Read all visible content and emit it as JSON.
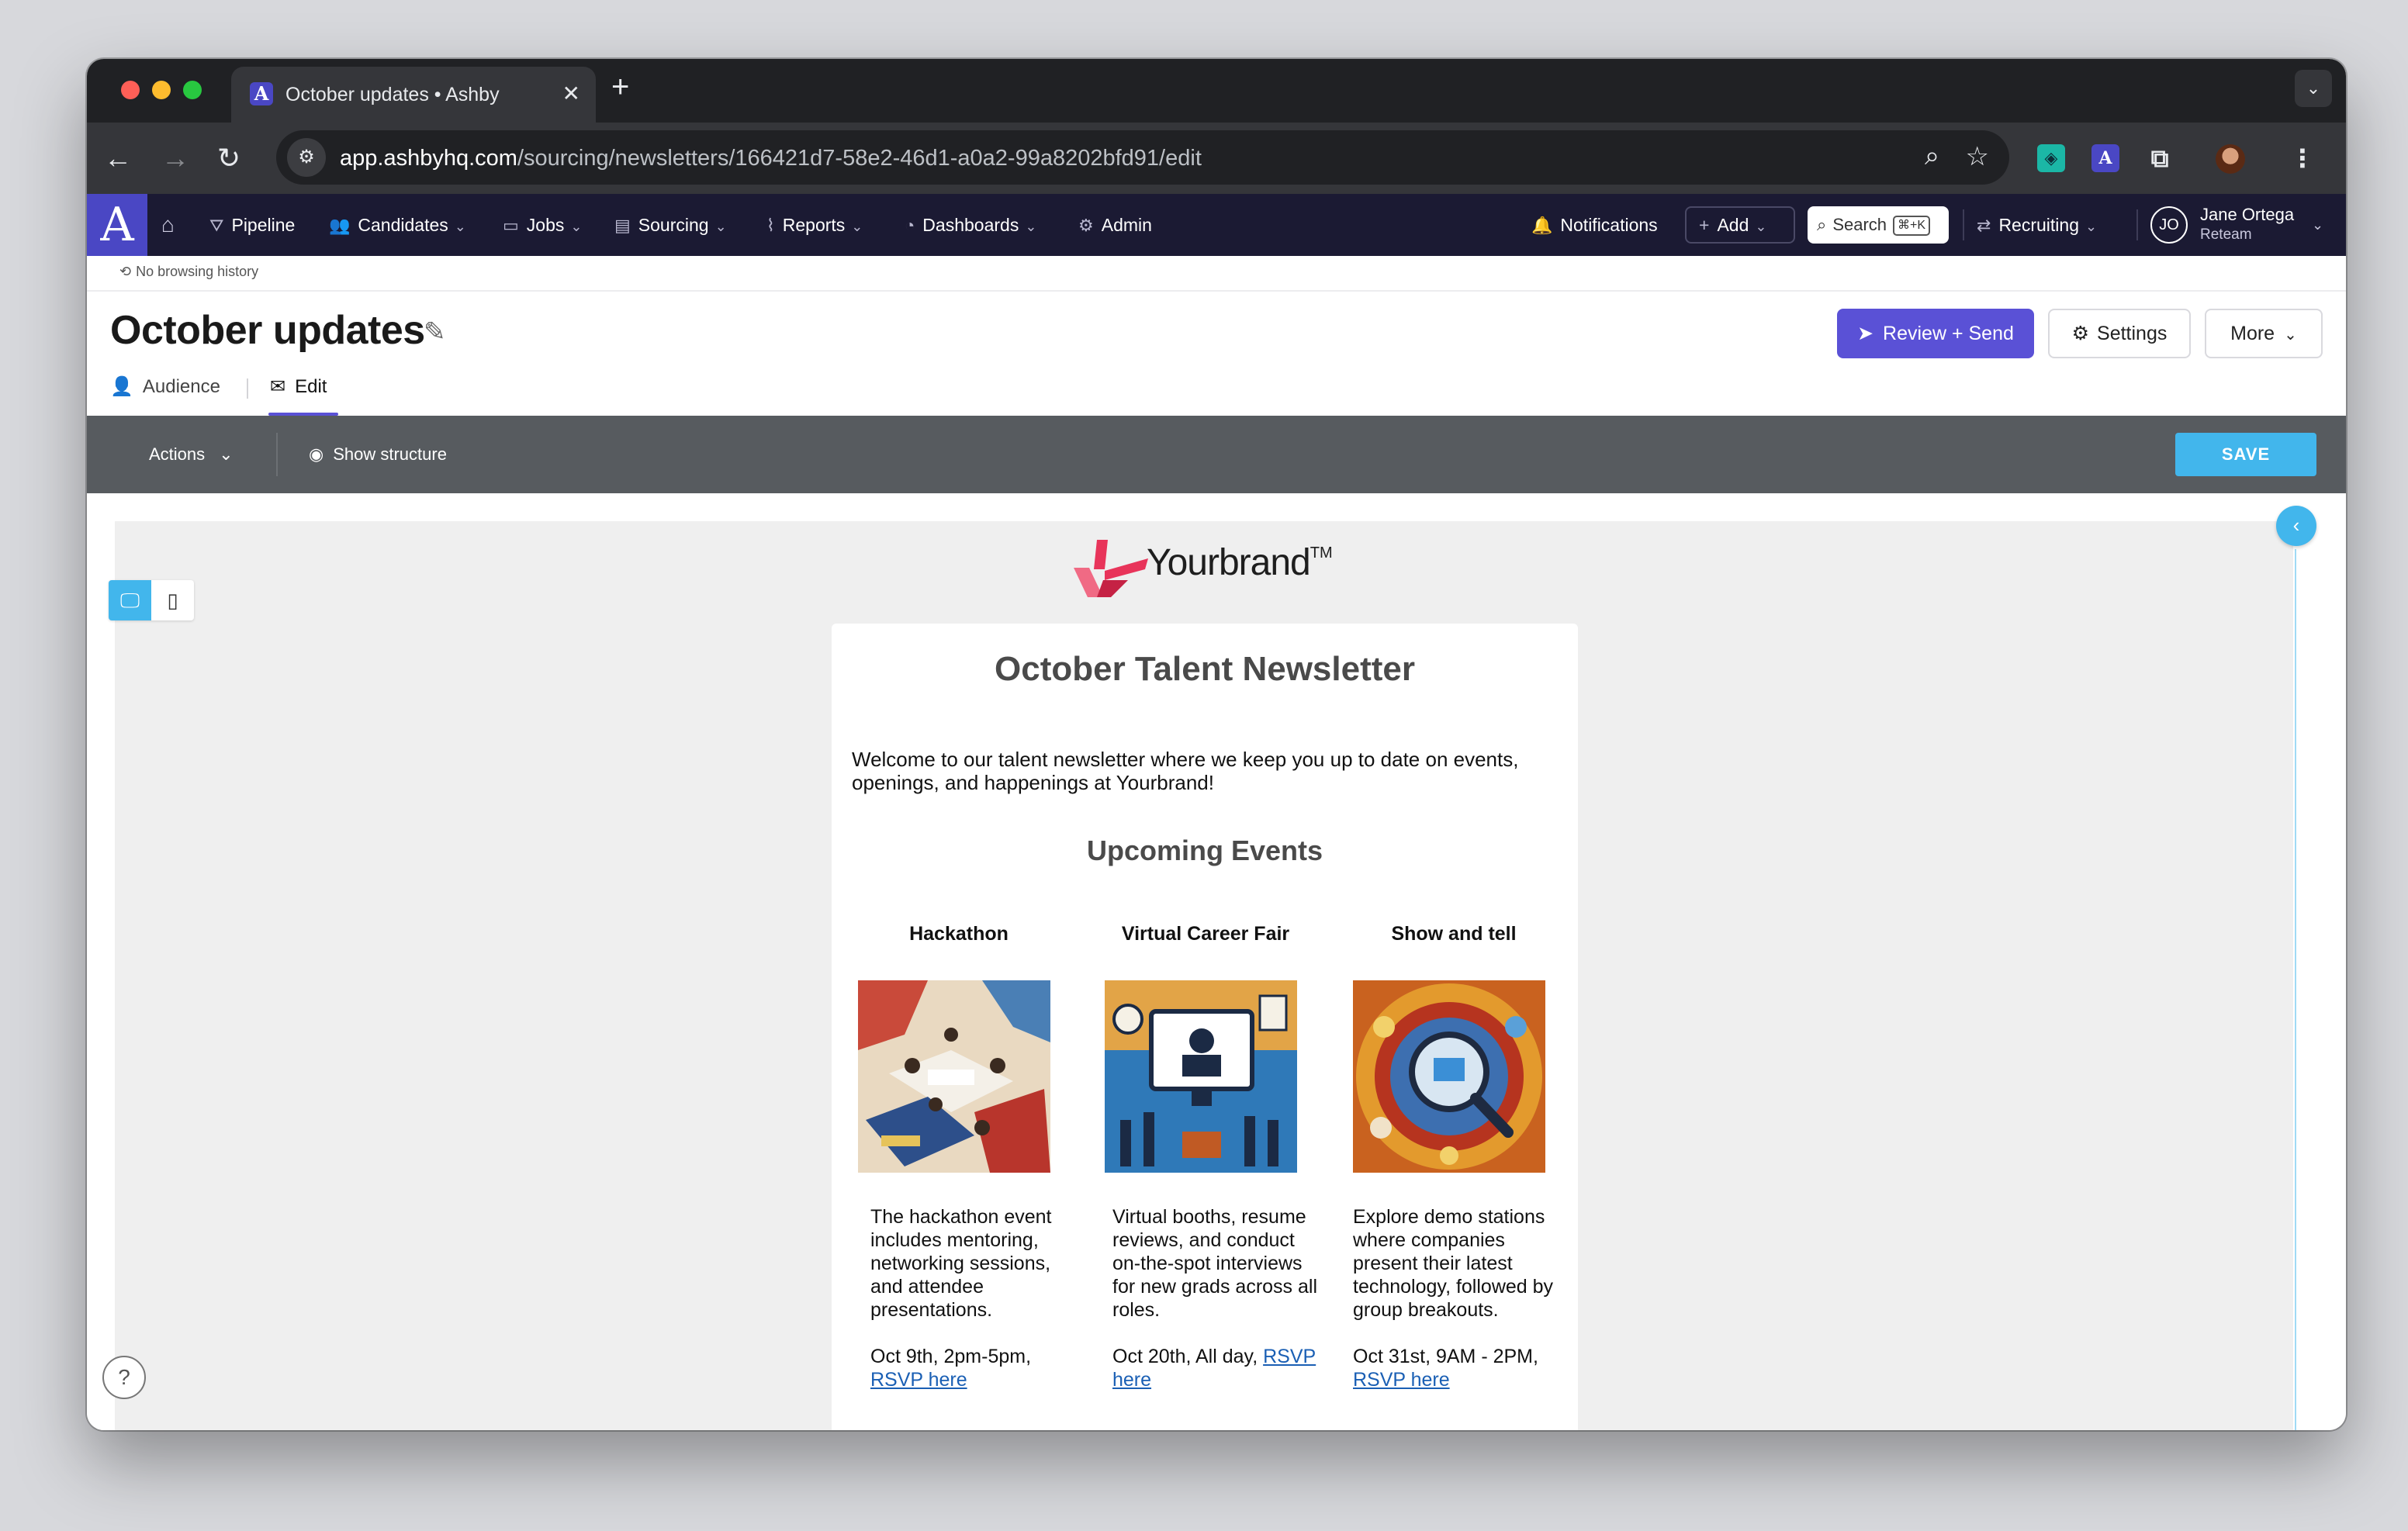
{
  "browser": {
    "tab_title": "October updates • Ashby",
    "tab_favicon": "A",
    "url_host": "app.ashbyhq.com",
    "url_path": "/sourcing/newsletters/166421d7-58e2-46d1-a0a2-99a8202bfd91/edit"
  },
  "nav": {
    "logo": "A",
    "items": [
      {
        "label": "Pipeline",
        "icon": "funnel-icon"
      },
      {
        "label": "Candidates",
        "icon": "people-icon"
      },
      {
        "label": "Jobs",
        "icon": "briefcase-icon"
      },
      {
        "label": "Sourcing",
        "icon": "inbox-icon"
      },
      {
        "label": "Reports",
        "icon": "chart-icon"
      },
      {
        "label": "Dashboards",
        "icon": "gauge-icon"
      },
      {
        "label": "Admin",
        "icon": "gear-icon"
      }
    ],
    "notifications": "Notifications",
    "add": "Add",
    "search": "Search",
    "search_shortcut": "⌘+K",
    "recruiting": "Recruiting",
    "user_initials": "JO",
    "user_name": "Jane Ortega",
    "user_org": "Reteam"
  },
  "history": "No browsing history",
  "page": {
    "title": "October updates",
    "review_send": "Review + Send",
    "settings": "Settings",
    "more": "More",
    "tabs": [
      {
        "label": "Audience"
      },
      {
        "label": "Edit"
      }
    ]
  },
  "editor": {
    "actions": "Actions",
    "show_structure": "Show structure",
    "save": "SAVE",
    "help": "?"
  },
  "email": {
    "brand": "Yourbrand",
    "brand_tm": "TM",
    "title": "October Talent Newsletter",
    "intro": "Welcome to our talent newsletter where we keep you up to date on events, openings, and happenings at Yourbrand!",
    "subtitle": "Upcoming Events",
    "events": [
      {
        "name": "Hackathon",
        "desc": "The hackathon event includes mentoring, networking sessions, and attendee presentations.",
        "when": "Oct 9th, 2pm-5pm,",
        "link": "RSVP here"
      },
      {
        "name": "Virtual Career Fair",
        "desc": "Virtual booths, resume reviews, and conduct on-the-spot interviews for new grads across all roles.",
        "when": "Oct 20th, All day,",
        "link": "RSVP here"
      },
      {
        "name": "Show and tell",
        "desc": "Explore demo stations where companies present their latest technology, followed by group breakouts.",
        "when": "Oct 31st, 9AM - 2PM,",
        "link": "RSVP here"
      }
    ]
  },
  "colors": {
    "nav_bg": "#1b1a33",
    "accent": "#5a51d6",
    "save_blue": "#42b6ec",
    "brand_pink": "#e8345a"
  }
}
